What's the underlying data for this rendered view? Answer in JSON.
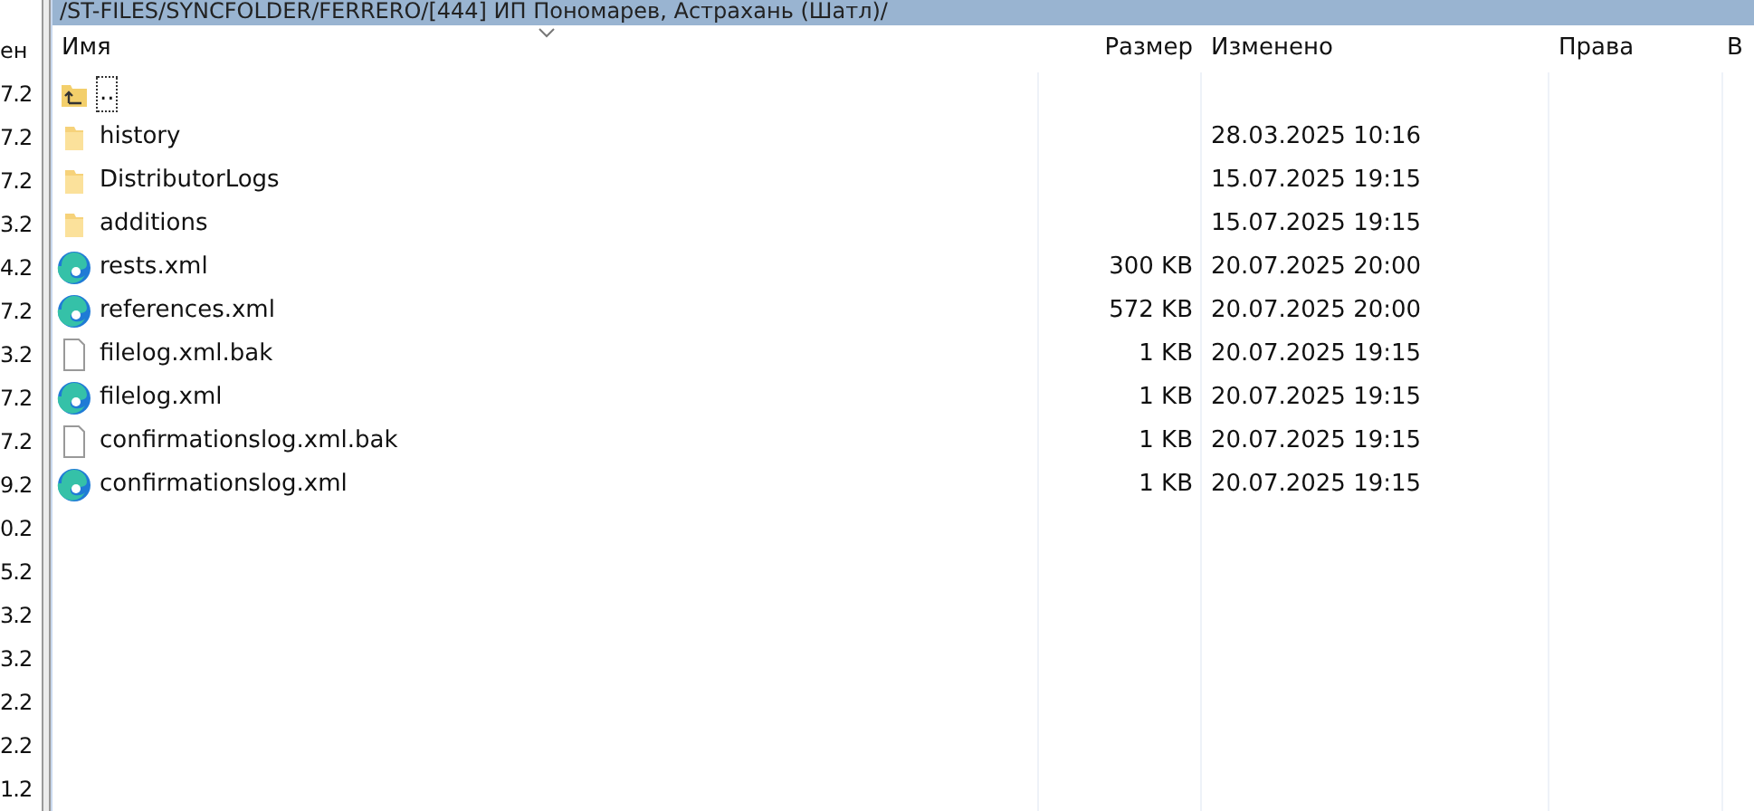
{
  "left_pane": {
    "header": "ен",
    "cells": [
      "7.2",
      "7.2",
      "7.2",
      "3.2",
      "4.2",
      "7.2",
      "3.2",
      "7.2",
      "7.2",
      "9.2",
      "0.2",
      "5.2",
      "3.2",
      "3.2",
      "2.2",
      "2.2",
      "1.2"
    ]
  },
  "path_bar": {
    "text": "/ST-FILES/SYNCFOLDER/FERRERO/[444] ИП Пономарев, Астрахань (Шатл)/"
  },
  "table": {
    "columns": [
      "Имя",
      "Размер",
      "Изменено",
      "Права",
      "В"
    ],
    "rows": [
      {
        "kind": "parent",
        "name": "..",
        "size": "",
        "modified": "",
        "focused": true
      },
      {
        "kind": "folder",
        "name": "history",
        "modified": "28.03.2025 10:16",
        "focused": false
      },
      {
        "kind": "folder",
        "name": "DistributorLogs",
        "modified": "15.07.2025 19:15",
        "focused": false
      },
      {
        "kind": "folder",
        "name": "additions",
        "modified": "15.07.2025 19:15",
        "focused": false
      },
      {
        "kind": "xml",
        "name": "rests.xml",
        "size": "300 KB",
        "modified": "20.07.2025 20:00",
        "focused": false
      },
      {
        "kind": "xml",
        "name": "references.xml",
        "size": "572 KB",
        "modified": "20.07.2025 20:00",
        "focused": false
      },
      {
        "kind": "file",
        "name": "filelog.xml.bak",
        "size": "1 KB",
        "modified": "20.07.2025 19:15",
        "focused": false
      },
      {
        "kind": "xml",
        "name": "filelog.xml",
        "size": "1 KB",
        "modified": "20.07.2025 19:15",
        "focused": false
      },
      {
        "kind": "file",
        "name": "confirmationslog.xml.bak",
        "size": "1 KB",
        "modified": "20.07.2025 19:15",
        "focused": false
      },
      {
        "kind": "xml",
        "name": "confirmationslog.xml",
        "size": "1 KB",
        "modified": "20.07.2025 19:15",
        "focused": false
      }
    ]
  }
}
